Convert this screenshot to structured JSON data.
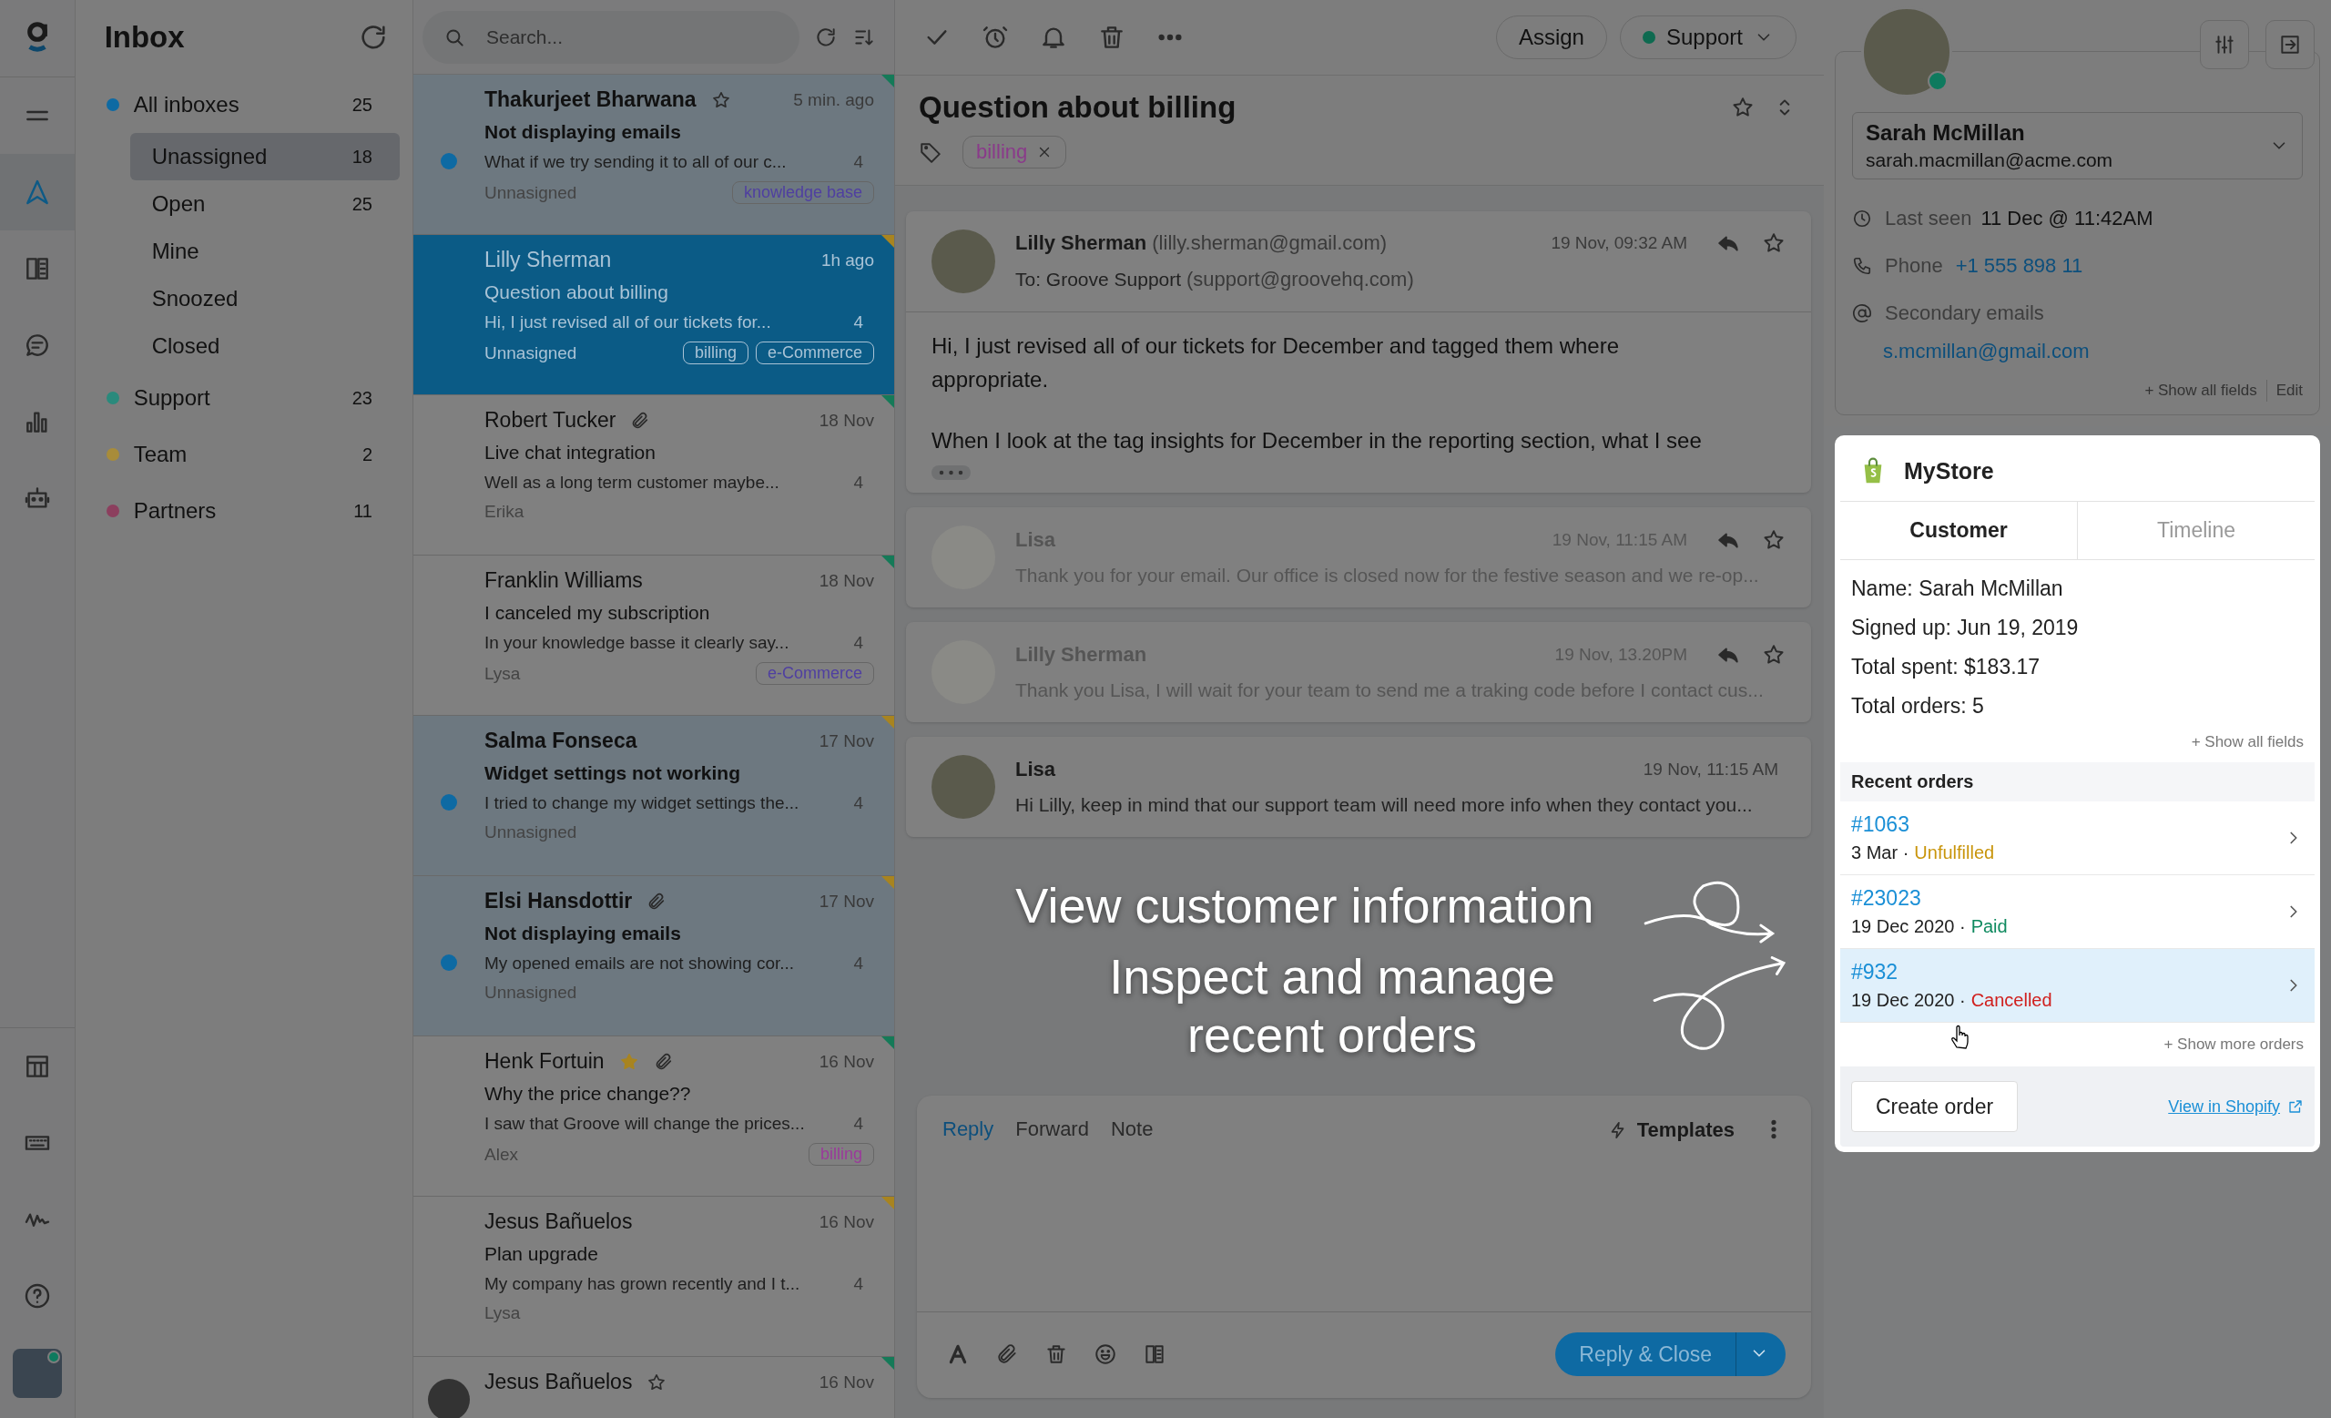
{
  "nav": {
    "top": [
      {
        "kind": "menu",
        "selected": false
      },
      {
        "kind": "send",
        "selected": true
      },
      {
        "kind": "book",
        "selected": false
      },
      {
        "kind": "chat",
        "selected": false
      },
      {
        "kind": "chart",
        "selected": false
      },
      {
        "kind": "robot",
        "selected": false
      }
    ],
    "bottom": [
      {
        "kind": "table",
        "selected": false
      },
      {
        "kind": "keyboard",
        "selected": false
      },
      {
        "kind": "activity",
        "selected": false
      },
      {
        "kind": "help",
        "selected": false
      }
    ],
    "user": {
      "online": true
    }
  },
  "sidebar": {
    "title": "Inbox",
    "folders": [
      {
        "label": "All inboxes",
        "count": "25",
        "color": "#0e6aa3",
        "selected": false,
        "children": [
          {
            "label": "Unassigned",
            "count": "18",
            "selected": true
          },
          {
            "label": "Open",
            "count": "25",
            "selected": false
          },
          {
            "label": "Mine",
            "selected": false
          },
          {
            "label": "Snoozed",
            "selected": false
          },
          {
            "label": "Closed",
            "selected": false
          }
        ]
      },
      {
        "label": "Support",
        "count": "23",
        "color": "#2a8a7c",
        "selected": false
      },
      {
        "label": "Team",
        "count": "2",
        "color": "#a88c3a",
        "selected": false
      },
      {
        "label": "Partners",
        "count": "11",
        "color": "#8c3f5e",
        "selected": false
      }
    ]
  },
  "conversations": {
    "search": {
      "placeholder": "Search..."
    },
    "rows": [
      {
        "name": "Thakurjeet Bharwana",
        "starred": false,
        "attachment": false,
        "time": "5 min. ago",
        "subject": "Not displaying emails",
        "preview": "What if we try sending it to all of our c...",
        "count": "4",
        "assignee": "Unnasigned",
        "tags": [
          {
            "label": "knowledge base",
            "color": "#4f3fa0"
          }
        ],
        "unread": true,
        "selected": false,
        "color": "#157a58"
      },
      {
        "name": "Lilly Sherman",
        "attachment": false,
        "time": "1h ago",
        "subject": "Question about billing",
        "preview": "Hi, I just revised all of our tickets for...",
        "count": "4",
        "assignee": "Unnasigned",
        "tags": [
          {
            "label": "billing",
            "color": "#a9c3d6"
          },
          {
            "label": "e-Commerce",
            "color": "#a9c3d6"
          }
        ],
        "unread": false,
        "selected": true,
        "color": "#a88420"
      },
      {
        "name": "Robert Tucker",
        "attachment": true,
        "time": "18 Nov",
        "subject": "Live chat integration",
        "preview": "Well as a long term customer maybe...",
        "count": "4",
        "assignee": "Erika",
        "tags": [],
        "unread": false,
        "selected": false,
        "color": "#157a58"
      },
      {
        "name": "Franklin Williams",
        "attachment": false,
        "time": "18 Nov",
        "subject": "I canceled my subscription",
        "preview": "In your knowledge basse it clearly say...",
        "count": "4",
        "assignee": "Lysa",
        "tags": [
          {
            "label": "e-Commerce",
            "color": "#4f3fa0"
          }
        ],
        "unread": false,
        "selected": false,
        "color": "#157a58"
      },
      {
        "name": "Salma Fonseca",
        "attachment": false,
        "time": "17 Nov",
        "subject": "Widget settings not working",
        "preview": "I tried to change my widget settings the...",
        "count": "4",
        "assignee": "Unnasigned",
        "tags": [],
        "unread": true,
        "selected": false,
        "color": "#a88420"
      },
      {
        "name": "Elsi Hansdottir",
        "attachment": true,
        "time": "17 Nov",
        "subject": "Not displaying emails",
        "preview": "My opened emails are not showing cor...",
        "count": "4",
        "assignee": "Unnasigned",
        "tags": [],
        "unread": true,
        "selected": false,
        "color": "#a88420"
      },
      {
        "name": "Henk Fortuin",
        "starred": true,
        "attachment": true,
        "time": "16 Nov",
        "subject": "Why the price change??",
        "preview": "I saw that Groove will change the prices...",
        "count": "4",
        "assignee": "Alex",
        "tags": [
          {
            "label": "billing",
            "color": "#9a3a9a"
          }
        ],
        "unread": false,
        "selected": false,
        "color": "#157a58"
      },
      {
        "name": "Jesus Bañuelos",
        "attachment": false,
        "time": "16 Nov",
        "subject": "Plan upgrade",
        "preview": "My company has grown recently and I t...",
        "count": "4",
        "assignee": "Lysa",
        "tags": [],
        "unread": false,
        "selected": false,
        "color": "#a88420"
      },
      {
        "name": "Jesus Bañuelos",
        "starred": false,
        "avatar": true,
        "time": "16 Nov",
        "tags": [],
        "unread": false,
        "selected": false,
        "color": "#157a58"
      }
    ]
  },
  "ticket": {
    "toolbar": {
      "assign": "Assign",
      "group": "Support"
    },
    "title": "Question about billing",
    "tags": [
      "billing"
    ],
    "messages": [
      {
        "kind": "expanded",
        "faded": false,
        "actions": true,
        "name": "Lilly Sherman",
        "email": "(lilly.sherman@gmail.com)",
        "to": "To: Groove Support",
        "to_email": "(support@groovehq.com)",
        "time": "19 Nov, 09:32 AM",
        "body": [
          "Hi, I just revised all of our tickets for December and tagged them where appropriate.",
          "When I look at the tag insights for December in the reporting section, what I see"
        ]
      },
      {
        "kind": "collapsed",
        "faded": true,
        "actions": true,
        "name": "Lisa",
        "time": "19 Nov, 11:15 AM",
        "preview": "Thank you for your email. Our office is closed now for the festive season and we re-op..."
      },
      {
        "kind": "collapsed",
        "faded": true,
        "actions": true,
        "name": "Lilly Sherman",
        "time": "19 Nov, 13.20PM",
        "preview": "Thank you Lisa, I will wait for your team to send me a traking code before I contact cus..."
      },
      {
        "kind": "collapsed",
        "faded": false,
        "actions": false,
        "name": "Lisa",
        "time": "19 Nov, 11:15 AM",
        "preview": "Hi Lilly, keep in mind that our support team will need more info when they contact you..."
      }
    ],
    "composer": {
      "tabs": [
        {
          "label": "Reply",
          "selected": true
        },
        {
          "label": "Forward",
          "selected": false
        },
        {
          "label": "Note",
          "selected": false
        }
      ],
      "templates": "Templates",
      "send": "Reply & Close"
    }
  },
  "annotations": [
    {
      "text": "View customer information"
    },
    {
      "text": "Inspect and manage recent orders"
    }
  ],
  "customer": {
    "online": true,
    "name": "Sarah McMillan",
    "email": "sarah.macmillan@acme.com",
    "fields": [
      {
        "kind": "clock",
        "label": "Last seen",
        "value": "11 Dec @ 11:42AM",
        "link": false
      },
      {
        "kind": "phone",
        "label": "Phone",
        "value": "+1 555 898 11",
        "link": true
      },
      {
        "kind": "at",
        "label": "Secondary emails"
      }
    ],
    "secondary_email": "s.mcmillan@gmail.com",
    "show_all": "+ Show all fields",
    "edit": "Edit"
  },
  "store": {
    "name": "MyStore",
    "tabs": [
      {
        "label": "Customer",
        "selected": true
      },
      {
        "label": "Timeline",
        "selected": false
      }
    ],
    "fields": [
      {
        "label": "Name:",
        "value": "Sarah McMillan"
      },
      {
        "label": "Signed up:",
        "value": "Jun 19, 2019"
      },
      {
        "label": "Total spent:",
        "value": "$183.17"
      },
      {
        "label": "Total orders:",
        "value": "5"
      }
    ],
    "show_all": "+ Show all fields",
    "orders_title": "Recent orders",
    "orders": [
      {
        "id": "#1063",
        "date": "3 Mar ·",
        "status": "Unfulfilled",
        "color": "#c9950c",
        "selected": false
      },
      {
        "id": "#23023",
        "date": "19 Dec 2020 ·",
        "status": "Paid",
        "color": "#0f8a5f",
        "selected": false
      },
      {
        "id": "#932",
        "date": "19 Dec 2020 ·",
        "status": "Cancelled",
        "color": "#d0201e",
        "selected": true
      }
    ],
    "show_more": "+ Show more orders",
    "create": "Create order",
    "view": "View in Shopify"
  }
}
